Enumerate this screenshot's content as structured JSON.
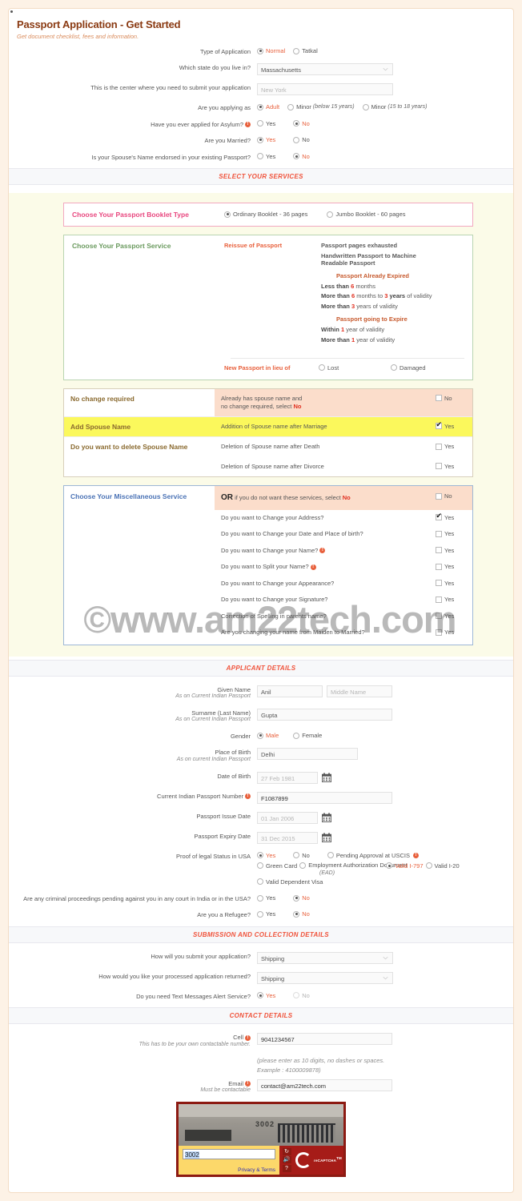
{
  "header": {
    "title": "Passport Application - Get Started",
    "subtitle": "Get document checklist, fees and information."
  },
  "get_started": {
    "type_label": "Type of Application",
    "type_options": [
      "Normal",
      "Tatkal"
    ],
    "type_selected": "Normal",
    "state_label": "Which state do you live in?",
    "state_value": "Massachusetts",
    "center_label": "This is the center where you need to submit your application",
    "center_value": "New York",
    "applying_label": "Are you applying as",
    "applying_options": [
      "Adult",
      "Minor",
      "Minor"
    ],
    "applying_notes": [
      "",
      "(below 15 years)",
      "(15 to 18 years)"
    ],
    "applying_selected": "Adult",
    "asylum_label": "Have you ever applied for Asylum?",
    "asylum_options": [
      "Yes",
      "No"
    ],
    "asylum_selected": "No",
    "married_label": "Are you Married?",
    "married_options": [
      "Yes",
      "No"
    ],
    "married_selected": "Yes",
    "spouse_endorsed_label": "Is your Spouse's Name endorsed in your existing Passport?",
    "spouse_endorsed_options": [
      "Yes",
      "No"
    ],
    "spouse_endorsed_selected": "No"
  },
  "sections": {
    "services": "SELECT YOUR SERVICES",
    "applicant": "APPLICANT DETAILS",
    "submission": "SUBMISSION AND COLLECTION DETAILS",
    "contact": "CONTACT DETAILS"
  },
  "booklet": {
    "title": "Choose Your Passport Booklet Type",
    "options": [
      "Ordinary Booklet - 36 pages",
      "Jumbo Booklet - 60 pages"
    ],
    "selected": "Ordinary Booklet - 36 pages"
  },
  "passport_service": {
    "title": "Choose Your Passport Service",
    "reissue_label": "Reissue of Passport",
    "opt_pages_exhausted": "Passport pages exhausted",
    "opt_handwritten": "Handwritten Passport to Machine Readable Passport",
    "group_expired": "Passport Already Expired",
    "expired_1_a": "Less than",
    "expired_1_n": "6",
    "expired_1_b": "months",
    "expired_2_a": "More than",
    "expired_2_n": "6",
    "expired_2_b": "months to",
    "expired_2_n2": "3",
    "expired_2_c": "years",
    "expired_2_d": "of validity",
    "expired_3_a": "More than",
    "expired_3_n": "3",
    "expired_3_b": "years of validity",
    "group_expiring": "Passport going to Expire",
    "expiring_1_a": "Within",
    "expiring_1_n": "1",
    "expiring_1_b": "year of validity",
    "expiring_2_a": "More than",
    "expiring_2_n": "1",
    "expiring_2_b": "year of validity",
    "selected": "Within 1 year of validity",
    "lieu_label": "New Passport in lieu of",
    "lieu_options": [
      "Lost",
      "Damaged"
    ]
  },
  "spouse_table": {
    "rows": [
      {
        "left": "No change required",
        "mid_a": "Already has spouse name and",
        "mid_b": "no change required, select",
        "mid_red": "No",
        "check_label": "No",
        "checked": false,
        "highlight": "peach"
      },
      {
        "left": "Add Spouse Name",
        "mid_a": "Addition of Spouse name after Marriage",
        "check_label": "Yes",
        "checked": true,
        "highlight": "yellow"
      },
      {
        "left": "Do you want to delete Spouse Name",
        "mid_a": "Deletion of Spouse name after Death",
        "check_label": "Yes",
        "checked": false,
        "highlight": "none"
      },
      {
        "left": "",
        "mid_a": "Deletion of Spouse name after Divorce",
        "check_label": "Yes",
        "checked": false,
        "highlight": "none"
      }
    ]
  },
  "misc_service": {
    "title": "Choose Your Miscellaneous Service",
    "or_bold": "OR",
    "or_text": "if you do not want these services, select",
    "or_red": "No",
    "or_check_label": "No",
    "or_checked": false,
    "rows": [
      {
        "label": "Do you want to Change your Address?",
        "check_label": "Yes",
        "checked": true,
        "info": false
      },
      {
        "label": "Do you want to Change your Date and Place of birth?",
        "check_label": "Yes",
        "checked": false,
        "info": false
      },
      {
        "label": "Do you want to Change your Name?",
        "check_label": "Yes",
        "checked": false,
        "info": true
      },
      {
        "label": "Do you want to Split your Name?",
        "check_label": "Yes",
        "checked": false,
        "info": true
      },
      {
        "label": "Do you want to Change your Appearance?",
        "check_label": "Yes",
        "checked": false,
        "info": false
      },
      {
        "label": "Do you want to Change your Signature?",
        "check_label": "Yes",
        "checked": false,
        "info": false
      },
      {
        "label": "Correction of Spelling in parents name?",
        "check_label": "Yes",
        "checked": false,
        "info": false
      },
      {
        "label": "Are you changing your name from Maiden to Married?",
        "check_label": "Yes",
        "checked": false,
        "info": false
      }
    ]
  },
  "applicant": {
    "given_name_label": "Given Name",
    "given_name_sub": "As on Current Indian Passport",
    "given_name_value": "Anil",
    "middle_name_placeholder": "Middle Name",
    "surname_label": "Surname (Last Name)",
    "surname_sub": "As on Current Indian Passport",
    "surname_value": "Gupta",
    "gender_label": "Gender",
    "gender_options": [
      "Male",
      "Female"
    ],
    "gender_selected": "Male",
    "pob_label": "Place of Birth",
    "pob_sub": "As on current Indian Passport",
    "pob_value": "Delhi",
    "dob_label": "Date of Birth",
    "dob_placeholder": "27 Feb 1981",
    "passport_no_label": "Current Indian Passport Number",
    "passport_no_value": "F1087899",
    "issue_label": "Passport Issue Date",
    "issue_placeholder": "01 Jan 2006",
    "expiry_label": "Passport Expiry Date",
    "expiry_placeholder": "31 Dec 2015",
    "legal_label": "Proof of legal Status in USA",
    "legal_row1": [
      "Yes",
      "No",
      "Pending Approval at USCIS"
    ],
    "legal_row1_selected": "Yes",
    "legal_row2": [
      "Green Card",
      "Employment Authorization Document",
      "Valid I-797",
      "Valid I-20"
    ],
    "legal_row2_ead_note": "(EAD)",
    "legal_row2_selected": "Valid I-797",
    "legal_row3": "Valid Dependent Visa",
    "criminal_label": "Are any criminal proceedings pending against you in any court in India or in the USA?",
    "criminal_options": [
      "Yes",
      "No"
    ],
    "criminal_selected": "No",
    "refugee_label": "Are you a Refugee?",
    "refugee_options": [
      "Yes",
      "No"
    ],
    "refugee_selected": "No"
  },
  "submission": {
    "submit_label": "How will you submit your application?",
    "submit_value": "Shipping",
    "return_label": "How would you like your processed application returned?",
    "return_value": "Shipping",
    "sms_label": "Do you need Text Messages Alert Service?",
    "sms_options": [
      "Yes",
      "No"
    ],
    "sms_selected": "Yes"
  },
  "contact": {
    "cell_label": "Cell",
    "cell_sub": "This has to be your own contactable number.",
    "cell_value": "9041234567",
    "cell_hint_a": "(please enter as 10 digits, no dashes or spaces.",
    "cell_hint_b": "Example : 4100009878)",
    "email_label": "Email",
    "email_sub": "Must be contactable",
    "email_value": "contact@am22tech.com"
  },
  "captcha": {
    "image_text": "3002",
    "input_value": "3002",
    "terms": "Privacy & Terms",
    "brand": "reCAPTCHA",
    "tm": "TM"
  },
  "watermark": "©www.am22tech.com",
  "colors": {
    "accent": "#e8603c",
    "heading": "#8a3a12",
    "section": "#f0523a",
    "pink": "#e8467e",
    "green": "#6a9a5e",
    "tan": "#8a6a2f",
    "blue": "#4a72b5",
    "red": "#e03020"
  }
}
